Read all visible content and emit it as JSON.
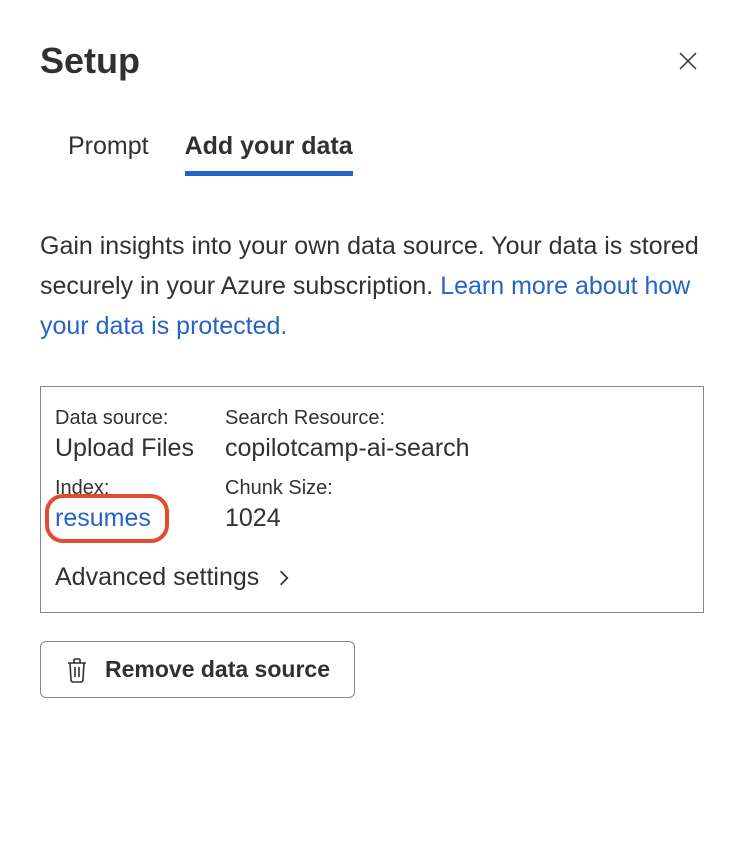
{
  "header": {
    "title": "Setup"
  },
  "tabs": {
    "prompt": "Prompt",
    "add_data": "Add your data"
  },
  "description": {
    "text": "Gain insights into your own data source. Your data is stored securely in your Azure subscription. ",
    "link": "Learn more about how your data is protected."
  },
  "panel": {
    "data_source_label": "Data source:",
    "data_source_value": "Upload Files",
    "search_resource_label": "Search Resource:",
    "search_resource_value": "copilotcamp-ai-search",
    "index_label": "Index:",
    "index_value": "resumes",
    "chunk_size_label": "Chunk Size:",
    "chunk_size_value": "1024",
    "advanced": "Advanced settings"
  },
  "remove_button": "Remove data source"
}
